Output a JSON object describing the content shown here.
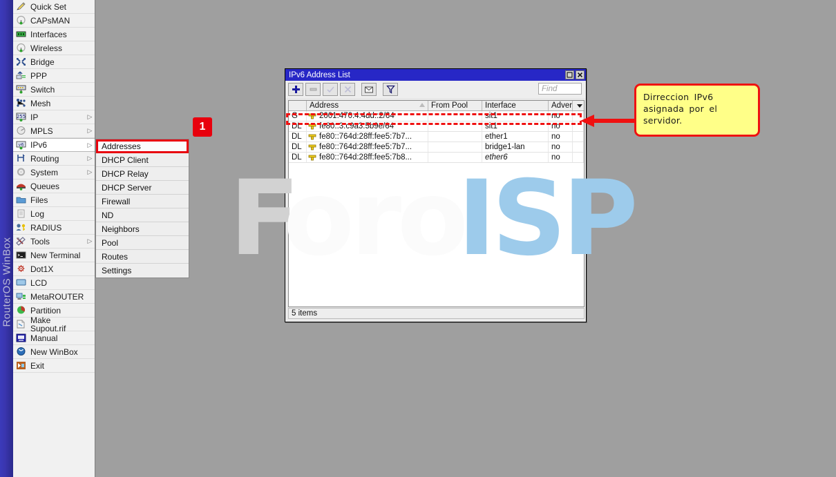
{
  "app": {
    "rail_label": "RouterOS WinBox",
    "background_color": "#9f9f9f",
    "accent_color": "#2727c6",
    "annotation_color": "#ef1111",
    "callout_fill": "#ffff88"
  },
  "sidebar": {
    "items": [
      {
        "label": "Quick Set",
        "icon": "pencil-icon",
        "arrow": ""
      },
      {
        "label": "CAPsMAN",
        "icon": "antenna-icon",
        "arrow": ""
      },
      {
        "label": "Interfaces",
        "icon": "interfaces-icon",
        "arrow": ""
      },
      {
        "label": "Wireless",
        "icon": "antenna-icon",
        "arrow": ""
      },
      {
        "label": "Bridge",
        "icon": "bridge-icon",
        "arrow": ""
      },
      {
        "label": "PPP",
        "icon": "ppp-icon",
        "arrow": ""
      },
      {
        "label": "Switch",
        "icon": "switch-icon",
        "arrow": ""
      },
      {
        "label": "Mesh",
        "icon": "mesh-icon",
        "arrow": ""
      },
      {
        "label": "IP",
        "icon": "ip-255-icon",
        "arrow": "▷"
      },
      {
        "label": "MPLS",
        "icon": "mpls-icon",
        "arrow": "▷"
      },
      {
        "label": "IPv6",
        "icon": "ipv6-icon",
        "arrow": "▷",
        "selected": true
      },
      {
        "label": "Routing",
        "icon": "routing-icon",
        "arrow": "▷"
      },
      {
        "label": "System",
        "icon": "gear-icon",
        "arrow": "▷"
      },
      {
        "label": "Queues",
        "icon": "queues-icon",
        "arrow": ""
      },
      {
        "label": "Files",
        "icon": "folder-icon",
        "arrow": ""
      },
      {
        "label": "Log",
        "icon": "log-icon",
        "arrow": ""
      },
      {
        "label": "RADIUS",
        "icon": "radius-key-icon",
        "arrow": ""
      },
      {
        "label": "Tools",
        "icon": "tools-icon",
        "arrow": "▷"
      },
      {
        "label": "New Terminal",
        "icon": "terminal-icon",
        "arrow": ""
      },
      {
        "label": "Dot1X",
        "icon": "dot1x-icon",
        "arrow": ""
      },
      {
        "label": "LCD",
        "icon": "lcd-icon",
        "arrow": ""
      },
      {
        "label": "MetaROUTER",
        "icon": "metarouter-icon",
        "arrow": ""
      },
      {
        "label": "Partition",
        "icon": "partition-icon",
        "arrow": ""
      },
      {
        "label": "Make Supout.rif",
        "icon": "document-icon",
        "arrow": ""
      },
      {
        "label": "Manual",
        "icon": "manual-icon",
        "arrow": ""
      },
      {
        "label": "New WinBox",
        "icon": "new-winbox-icon",
        "arrow": ""
      },
      {
        "label": "Exit",
        "icon": "exit-icon",
        "arrow": ""
      }
    ]
  },
  "submenu": {
    "items": [
      {
        "label": "Addresses",
        "highlighted": true
      },
      {
        "label": "DHCP Client",
        "highlighted": false
      },
      {
        "label": "DHCP Relay",
        "highlighted": false
      },
      {
        "label": "DHCP Server",
        "highlighted": false
      },
      {
        "label": "Firewall",
        "highlighted": false
      },
      {
        "label": "ND",
        "highlighted": false
      },
      {
        "label": "Neighbors",
        "highlighted": false
      },
      {
        "label": "Pool",
        "highlighted": false
      },
      {
        "label": "Routes",
        "highlighted": false
      },
      {
        "label": "Settings",
        "highlighted": false
      }
    ]
  },
  "badge": {
    "step_1": "1"
  },
  "window": {
    "title": "IPv6 Address List",
    "maximize_label": "□",
    "close_label": "✕",
    "toolbar": {
      "add_label": "+",
      "remove_label": "−",
      "enable_label": "✓",
      "disable_label": "✕",
      "comment_label": "comment",
      "filter_label": "filter"
    },
    "search": {
      "placeholder": "Find",
      "value": ""
    },
    "table": {
      "columns": [
        "",
        "Address",
        "From Pool",
        "Interface",
        "Advertise"
      ],
      "rows": [
        {
          "flag": "G",
          "address": "2001:470:4:4dd::2/64",
          "pool": "",
          "interface": "sit1",
          "interface_italic": false,
          "advertise": "no",
          "highlighted": true
        },
        {
          "flag": "DL",
          "address": "fe80::3:c9a3:5b9e/64",
          "pool": "",
          "interface": "sit1",
          "interface_italic": false,
          "advertise": "no",
          "highlighted": false
        },
        {
          "flag": "DL",
          "address": "fe80::764d:28ff:fee5:7b7...",
          "pool": "",
          "interface": "ether1",
          "interface_italic": false,
          "advertise": "no",
          "highlighted": false
        },
        {
          "flag": "DL",
          "address": "fe80::764d:28ff:fee5:7b7...",
          "pool": "",
          "interface": "bridge1-lan",
          "interface_italic": false,
          "advertise": "no",
          "highlighted": false
        },
        {
          "flag": "DL",
          "address": "fe80::764d:28ff:fee5:7b8...",
          "pool": "",
          "interface": "ether6",
          "interface_italic": true,
          "advertise": "no",
          "highlighted": false
        }
      ]
    },
    "status": "5 items"
  },
  "callout": {
    "text": "Dirreccion  IPv6\nasignada  por  el\nservidor."
  },
  "watermark": {
    "part_1": "F",
    "part_2": "oro",
    "part_3": "ISP"
  }
}
